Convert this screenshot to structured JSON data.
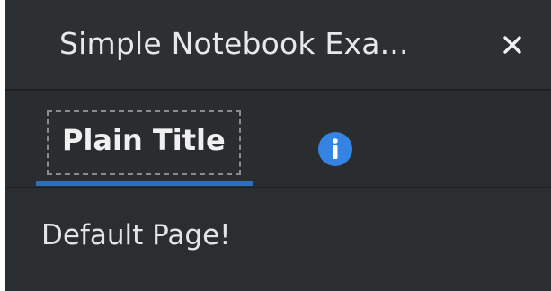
{
  "window": {
    "title": "Simple Notebook Exa..."
  },
  "notebook": {
    "tabs": [
      {
        "label": "Plain Title",
        "icon": "",
        "active": true
      },
      {
        "label": "",
        "icon": "info-icon",
        "active": false
      }
    ],
    "page_text": "Default Page!"
  },
  "colors": {
    "window_bg": "#2b2e31",
    "titlebar_bg": "#2d3033",
    "accent": "#2f6fba",
    "info_icon": "#3584e4"
  }
}
